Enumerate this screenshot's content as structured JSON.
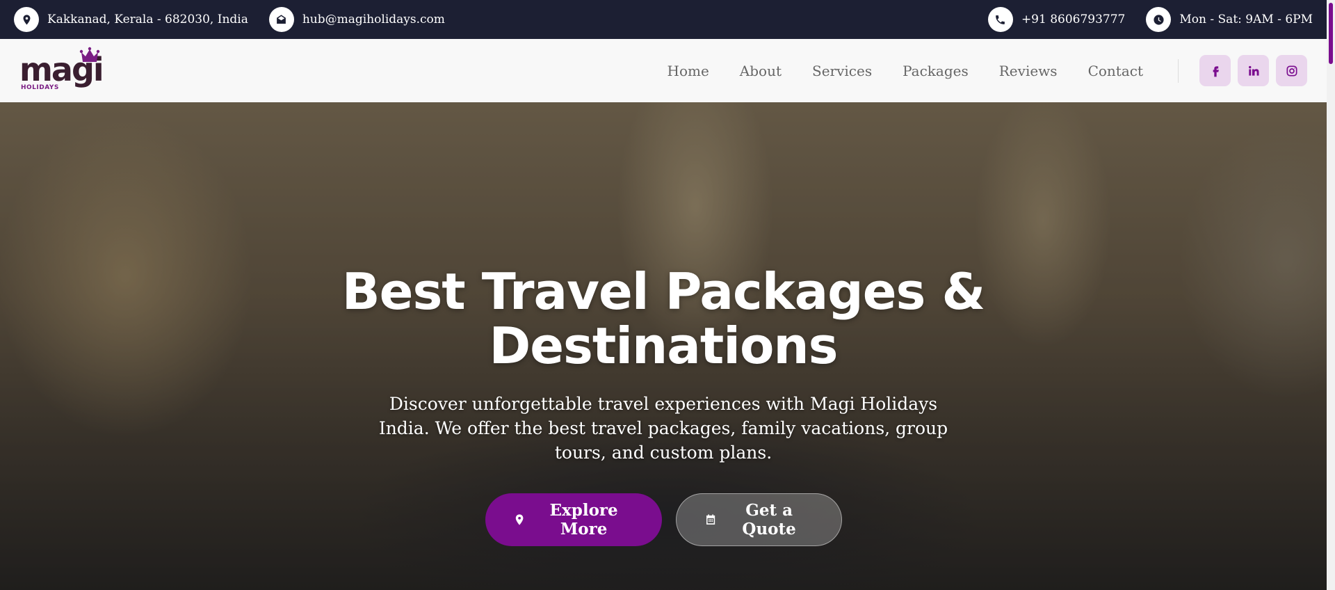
{
  "topbar": {
    "address": "Kakkanad, Kerala - 682030, India",
    "email": "hub@magiholidays.com",
    "phone": "+91 8606793777",
    "hours": "Mon - Sat: 9AM - 6PM"
  },
  "logo": {
    "text": "magi",
    "sub": "HOLIDAYS"
  },
  "nav": {
    "items": [
      "Home",
      "About",
      "Services",
      "Packages",
      "Reviews",
      "Contact"
    ]
  },
  "socials": [
    "facebook-icon",
    "linkedin-icon",
    "instagram-icon"
  ],
  "hero": {
    "title_line1": "Best Travel Packages &",
    "title_line2": "Destinations",
    "description": "Discover unforgettable travel experiences with Magi Holidays India. We offer the best travel packages, family vacations, group tours, and custom plans.",
    "primary_button": "Explore More",
    "secondary_button": "Get a Quote"
  },
  "colors": {
    "accent": "#7a0d8e",
    "topbar": "#1c1f33"
  }
}
